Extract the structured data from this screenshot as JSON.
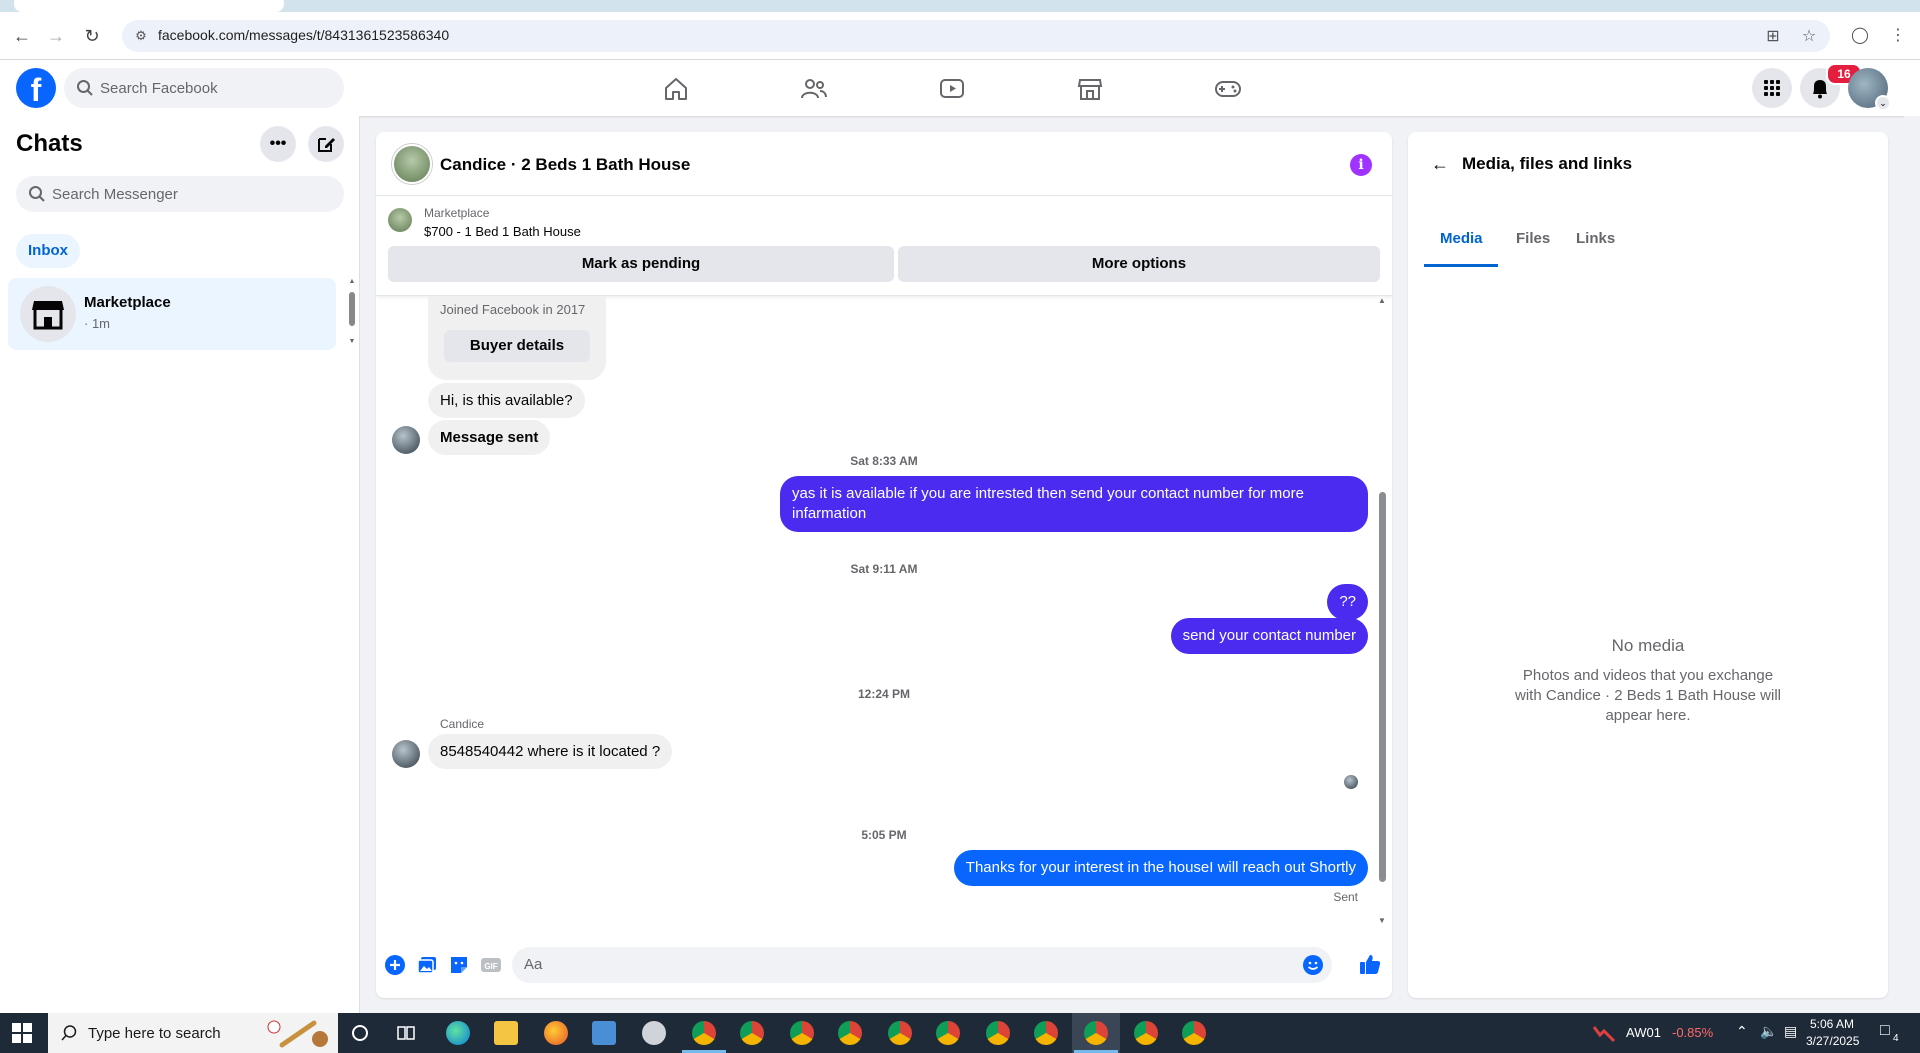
{
  "browser": {
    "url": "facebook.com/messages/t/8431361523586340"
  },
  "fb_header": {
    "logo": "f",
    "search_placeholder": "Search Facebook",
    "notification_count": "16"
  },
  "chats": {
    "title": "Chats",
    "more_label": "•••",
    "search_placeholder": "Search Messenger",
    "filter_inbox": "Inbox",
    "items": [
      {
        "name": "Marketplace",
        "time": "· 1m"
      }
    ]
  },
  "conversation": {
    "title": "Candice · 2 Beds 1 Bath House",
    "info_label": "i",
    "listing": {
      "source": "Marketplace",
      "item": "$700 - 1 Bed 1 Bath House",
      "btn_pending": "Mark as pending",
      "btn_more": "More options"
    },
    "buyer_card": {
      "joined": "Joined Facebook in 2017",
      "button": "Buyer details"
    },
    "messages": [
      {
        "from": "them",
        "text": "Hi, is this available?"
      },
      {
        "from": "them",
        "text": "Message sent"
      },
      {
        "type": "time",
        "text": "Sat 8:33 AM"
      },
      {
        "from": "me",
        "text": "yas it is available if you are intrested then send your contact number for more infarmation"
      },
      {
        "type": "time",
        "text": "Sat 9:11 AM"
      },
      {
        "from": "me",
        "text": "??"
      },
      {
        "from": "me",
        "text": "send your contact number"
      },
      {
        "type": "time",
        "text": "12:24 PM"
      },
      {
        "sender": "Candice",
        "from": "them",
        "text": "8548540442 where is it located ?"
      },
      {
        "type": "time",
        "text": "5:05 PM"
      },
      {
        "from": "me",
        "text": "Thanks for your interest in the houseI will reach out Shortly"
      }
    ],
    "sent_status": "Sent",
    "composer_placeholder": "Aa"
  },
  "media_panel": {
    "title": "Media, files and links",
    "tabs": [
      "Media",
      "Files",
      "Links"
    ],
    "active_tab": "Media",
    "empty_title": "No media",
    "empty_text": "Photos and videos that you exchange with Candice · 2 Beds 1 Bath House will appear here."
  },
  "taskbar": {
    "search_placeholder": "Type here to search",
    "ticker_symbol": "AW01",
    "ticker_change": "-0.85%",
    "time": "5:06 AM",
    "date": "3/27/2025",
    "notif_count": "4"
  },
  "colors": {
    "fb_blue": "#0866ff",
    "outgoing_purple": "#4b2bf0",
    "outgoing_blue": "#0866ff",
    "link_blue": "#0064d1",
    "ticker_red": "#ff6a6a"
  }
}
